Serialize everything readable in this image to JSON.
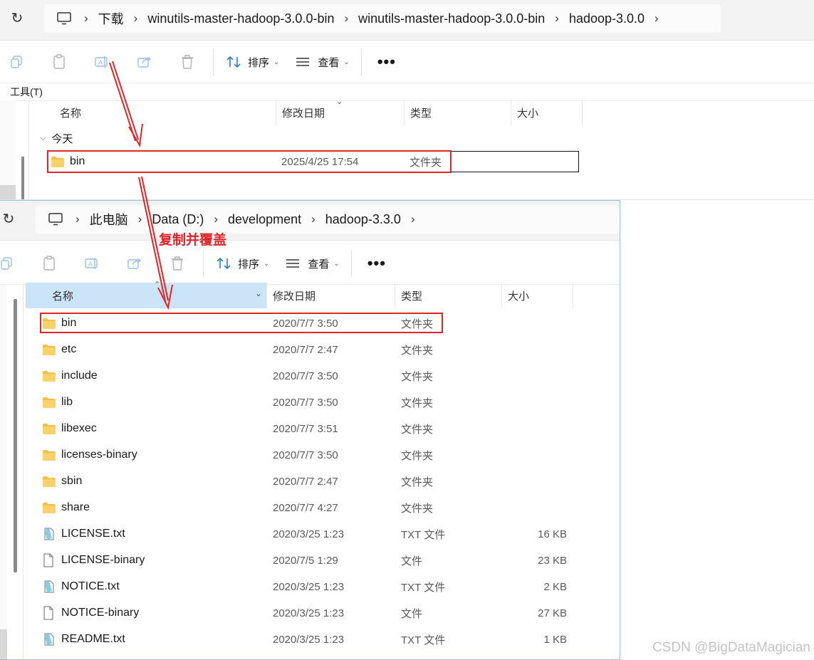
{
  "window1": {
    "breadcrumbs": [
      "下载",
      "winutils-master-hadoop-3.0.0-bin",
      "winutils-master-hadoop-3.0.0-bin",
      "hadoop-3.0.0"
    ],
    "toolbar": {
      "sort_label": "排序",
      "view_label": "查看",
      "more_label": "•••"
    },
    "menu": {
      "tools_label": "工具(T)"
    },
    "columns": {
      "name": "名称",
      "date": "修改日期",
      "type": "类型",
      "size": "大小"
    },
    "group": {
      "label": "今天"
    },
    "rows": [
      {
        "name": "bin",
        "date": "2025/4/25 17:54",
        "type": "文件夹",
        "size": ""
      }
    ]
  },
  "window2": {
    "breadcrumbs": [
      "此电脑",
      "Data (D:)",
      "development",
      "hadoop-3.3.0"
    ],
    "toolbar": {
      "sort_label": "排序",
      "view_label": "查看",
      "more_label": "•••"
    },
    "columns": {
      "name": "名称",
      "date": "修改日期",
      "type": "类型",
      "size": "大小"
    },
    "rows": [
      {
        "name": "bin",
        "date": "2020/7/7 3:50",
        "type": "文件夹",
        "size": "",
        "icon": "folder-icon"
      },
      {
        "name": "etc",
        "date": "2020/7/7 2:47",
        "type": "文件夹",
        "size": "",
        "icon": "folder-icon"
      },
      {
        "name": "include",
        "date": "2020/7/7 3:50",
        "type": "文件夹",
        "size": "",
        "icon": "folder-icon"
      },
      {
        "name": "lib",
        "date": "2020/7/7 3:50",
        "type": "文件夹",
        "size": "",
        "icon": "folder-icon"
      },
      {
        "name": "libexec",
        "date": "2020/7/7 3:51",
        "type": "文件夹",
        "size": "",
        "icon": "folder-icon"
      },
      {
        "name": "licenses-binary",
        "date": "2020/7/7 3:50",
        "type": "文件夹",
        "size": "",
        "icon": "folder-icon"
      },
      {
        "name": "sbin",
        "date": "2020/7/7 2:47",
        "type": "文件夹",
        "size": "",
        "icon": "folder-icon"
      },
      {
        "name": "share",
        "date": "2020/7/7 4:27",
        "type": "文件夹",
        "size": "",
        "icon": "folder-icon"
      },
      {
        "name": "LICENSE.txt",
        "date": "2020/3/25 1:23",
        "type": "TXT 文件",
        "size": "16 KB",
        "icon": "text-file-icon"
      },
      {
        "name": "LICENSE-binary",
        "date": "2020/7/5 1:29",
        "type": "文件",
        "size": "23 KB",
        "icon": "blank-file-icon"
      },
      {
        "name": "NOTICE.txt",
        "date": "2020/3/25 1:23",
        "type": "TXT 文件",
        "size": "2 KB",
        "icon": "text-file-icon"
      },
      {
        "name": "NOTICE-binary",
        "date": "2020/3/25 1:23",
        "type": "文件",
        "size": "27 KB",
        "icon": "blank-file-icon"
      },
      {
        "name": "README.txt",
        "date": "2020/3/25 1:23",
        "type": "TXT 文件",
        "size": "1 KB",
        "icon": "text-file-icon"
      }
    ]
  },
  "annotation": {
    "text": "复制并覆盖",
    "color": "#e0262a"
  },
  "watermark": "CSDN @BigDataMagician",
  "colors": {
    "folder": "#f3c14b",
    "selection": "#cce4f7",
    "highlight_border": "#e0262a"
  }
}
